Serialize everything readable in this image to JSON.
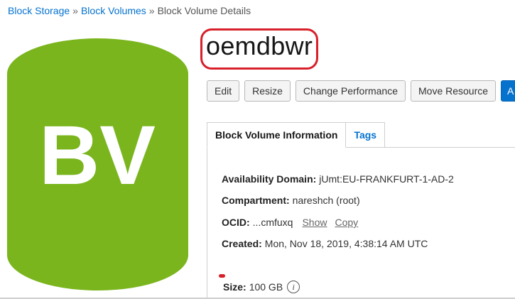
{
  "breadcrumb": {
    "items": [
      "Block Storage",
      "Block Volumes"
    ],
    "separator": "»",
    "current": "Block Volume Details"
  },
  "icon": {
    "text": "BV",
    "color": "#7ab51d",
    "name": "block-volume-icon"
  },
  "title": "oemdbwr",
  "actions": {
    "edit": "Edit",
    "resize": "Resize",
    "change_performance": "Change Performance",
    "move_resource": "Move Resource",
    "more": "A"
  },
  "tabs": [
    {
      "label": "Block Volume Information",
      "active": true
    },
    {
      "label": "Tags",
      "active": false
    }
  ],
  "details": {
    "availability_domain": {
      "label": "Availability Domain:",
      "value": "jUmt:EU-FRANKFURT-1-AD-2"
    },
    "compartment": {
      "label": "Compartment:",
      "value": "nareshch (root)"
    },
    "ocid": {
      "label": "OCID:",
      "value": "...cmfuxq",
      "show": "Show",
      "copy": "Copy"
    },
    "created": {
      "label": "Created:",
      "value": "Mon, Nov 18, 2019, 4:38:14 AM UTC"
    },
    "size": {
      "label": "Size:",
      "value": "100 GB",
      "info_icon": "info-icon"
    }
  },
  "colors": {
    "link": "#0572ce",
    "primary_button": "#0572ce",
    "annotation_red": "#d8202a",
    "icon_green": "#7ab51d"
  }
}
